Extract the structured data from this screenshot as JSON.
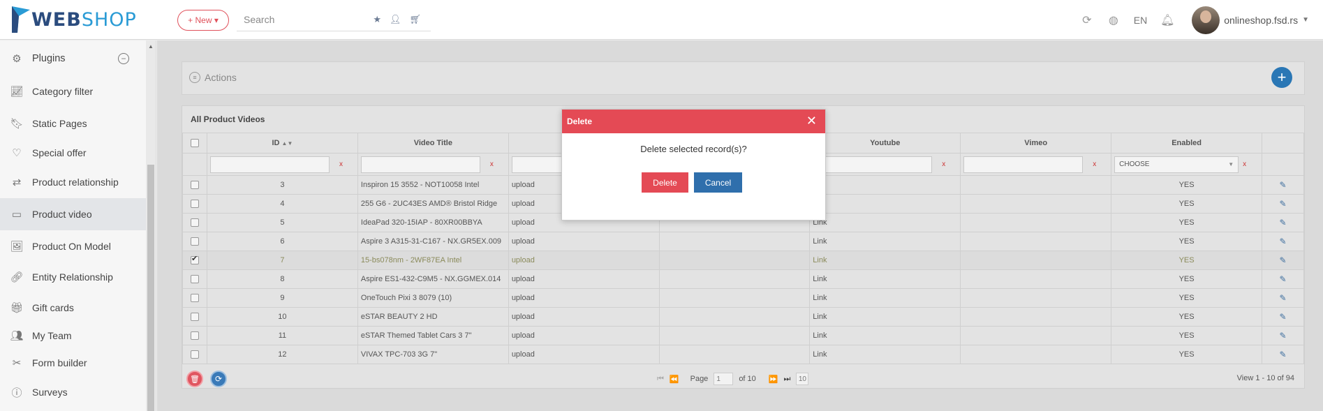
{
  "header": {
    "logo_web": "WEB",
    "logo_shop": "SHOP",
    "new_label": "+ New ▾",
    "search_placeholder": "Search",
    "lang": "EN",
    "shop_name": "onlineshop.fsd.rs"
  },
  "sidebar": {
    "head": "Plugins",
    "items": [
      {
        "label": "Category filter",
        "icon": "chart-icon"
      },
      {
        "label": "Static Pages",
        "icon": "bookmark-icon"
      },
      {
        "label": "Special offer",
        "icon": "heart-icon"
      },
      {
        "label": "Product relationship",
        "icon": "shuffle-icon"
      },
      {
        "label": "Product video",
        "icon": "video-icon"
      },
      {
        "label": "Product On Model",
        "icon": "image-icon"
      },
      {
        "label": "Entity Relationship",
        "icon": "link-icon"
      },
      {
        "label": "Gift cards",
        "icon": "gift-icon"
      },
      {
        "label": "My Team",
        "icon": "team-icon"
      },
      {
        "label": "Form builder",
        "icon": "tools-icon"
      },
      {
        "label": "Surveys",
        "icon": "question-icon"
      }
    ]
  },
  "actions": {
    "label": "Actions"
  },
  "grid": {
    "title": "All Product Videos",
    "columns": [
      "ID",
      "Video Title",
      "Youtube",
      "Vimeo",
      "Enabled"
    ],
    "choose": "CHOOSE",
    "rows": [
      {
        "id": "3",
        "title": "Inspiron 15 3552 - NOT10058 Intel",
        "type": "upload",
        "link": "",
        "enabled": "YES"
      },
      {
        "id": "4",
        "title": "255 G6 - 2UC43ES AMD® Bristol Ridge",
        "type": "upload",
        "link": "",
        "enabled": "YES"
      },
      {
        "id": "5",
        "title": "IdeaPad 320-15IAP - 80XR00BBYA",
        "type": "upload",
        "link": "Link",
        "enabled": "YES"
      },
      {
        "id": "6",
        "title": "Aspire 3 A315-31-C167 - NX.GR5EX.009",
        "type": "upload",
        "link": "Link",
        "enabled": "YES"
      },
      {
        "id": "7",
        "title": " 15-bs078nm - 2WF87EA Intel",
        "type": "upload",
        "link": "Link",
        "enabled": "YES"
      },
      {
        "id": "8",
        "title": " Aspire ES1-432-C9M5 - NX.GGMEX.014",
        "type": "upload",
        "link": "Link",
        "enabled": "YES"
      },
      {
        "id": "9",
        "title": "OneTouch Pixi 3 8079 (10)",
        "type": "upload",
        "link": "Link",
        "enabled": "YES"
      },
      {
        "id": "10",
        "title": "eSTAR BEAUTY 2 HD",
        "type": "upload",
        "link": "Link",
        "enabled": "YES"
      },
      {
        "id": "11",
        "title": "eSTAR Themed Tablet Cars 3 7\"",
        "type": "upload",
        "link": "Link",
        "enabled": "YES"
      },
      {
        "id": "12",
        "title": "VIVAX TPC-703 3G 7\"",
        "type": "upload",
        "link": "Link",
        "enabled": "YES"
      }
    ],
    "pager": {
      "page_label": "Page",
      "page": "1",
      "of": "of 10",
      "size": "10",
      "view": "View 1 - 10 of 94"
    }
  },
  "modal": {
    "title": "Delete",
    "message": "Delete selected record(s)?",
    "delete_label": "Delete",
    "cancel_label": "Cancel"
  }
}
